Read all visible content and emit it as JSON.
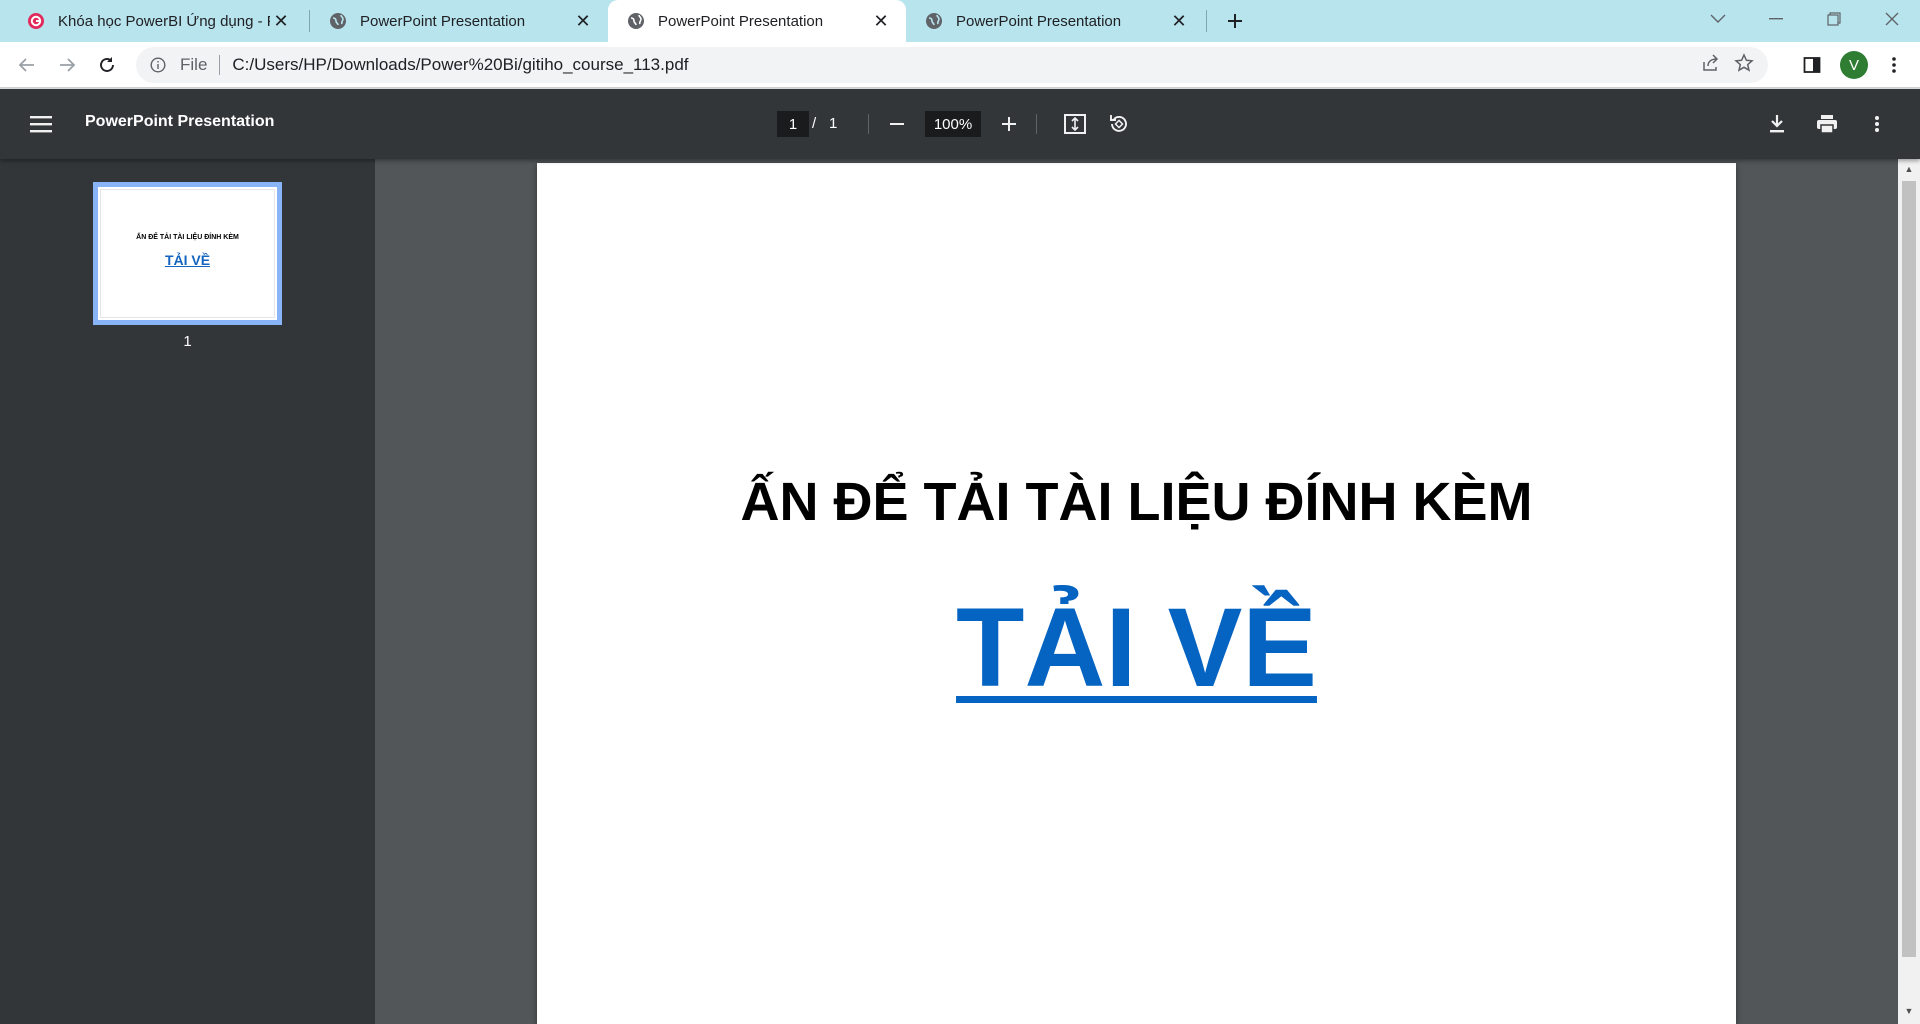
{
  "browser": {
    "tabs": [
      {
        "title": "Khóa học PowerBI Ứng dụng - Ph",
        "favicon": "gitiho-icon",
        "active": false
      },
      {
        "title": "PowerPoint Presentation",
        "favicon": "globe-icon",
        "active": false
      },
      {
        "title": "PowerPoint Presentation",
        "favicon": "globe-icon",
        "active": true
      },
      {
        "title": "PowerPoint Presentation",
        "favicon": "globe-icon",
        "active": false
      }
    ],
    "omnibox": {
      "scheme_label": "File",
      "url": "C:/Users/HP/Downloads/Power%20Bi/gitiho_course_113.pdf"
    },
    "profile_initial": "V"
  },
  "pdf_viewer": {
    "document_title": "PowerPoint Presentation",
    "current_page": "1",
    "page_separator": "/",
    "total_pages": "1",
    "zoom": "100%",
    "thumbnail": {
      "page_number": "1",
      "heading": "ẤN ĐỂ TẢI TÀI LIỆU ĐÍNH KÈM",
      "link": "TẢI VỀ"
    }
  },
  "page_content": {
    "heading": "ẤN ĐỂ TẢI TÀI LIỆU ĐÍNH KÈM",
    "download_link": "TẢI VỀ"
  },
  "colors": {
    "tabstrip": "#b8e4ee",
    "viewer_toolbar": "#323639",
    "viewer_background": "#525659",
    "link_blue": "#0563c1",
    "thumbnail_highlight": "#8ab4f8",
    "avatar": "#2e7d32"
  }
}
